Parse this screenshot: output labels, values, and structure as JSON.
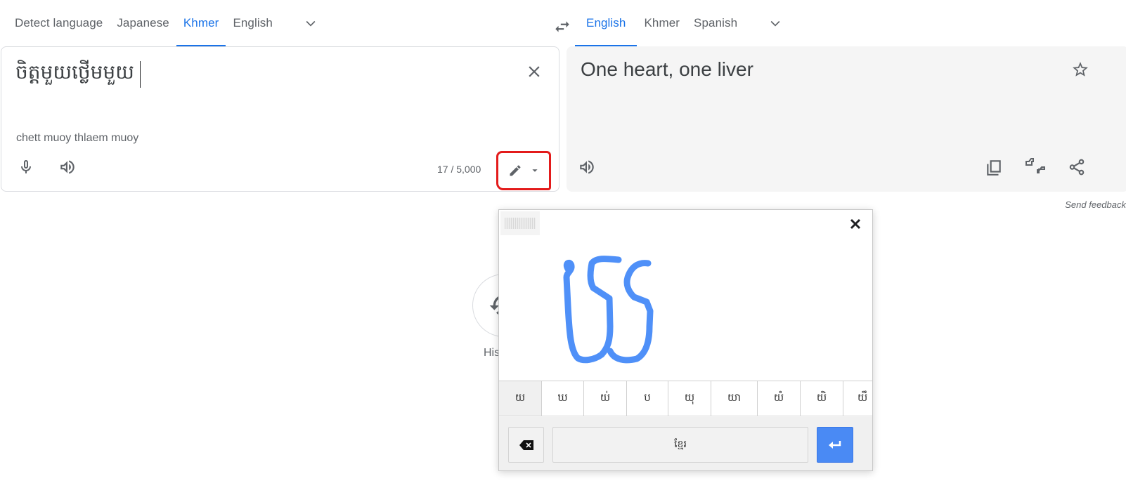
{
  "source_languages": {
    "tabs": [
      {
        "label": "Detect language",
        "active": false
      },
      {
        "label": "Japanese",
        "active": false
      },
      {
        "label": "Khmer",
        "active": true
      },
      {
        "label": "English",
        "active": false
      }
    ],
    "more_icon": "chevron-down-icon"
  },
  "swap_icon": "swap-arrows-icon",
  "target_languages": {
    "tabs": [
      {
        "label": "English",
        "active": true
      },
      {
        "label": "Khmer",
        "active": false
      },
      {
        "label": "Spanish",
        "active": false
      }
    ],
    "more_icon": "chevron-down-icon"
  },
  "source": {
    "text": "ចិត្តមួយថ្លើមមួយ",
    "transliteration": "chett muoy thlaem muoy",
    "char_count": "17 / 5,000",
    "icons": [
      "close-icon",
      "microphone-icon",
      "speaker-icon",
      "pencil-icon",
      "dropdown-arrow-icon"
    ],
    "annotation_color": "#e31b1b"
  },
  "target": {
    "text": "One heart, one liver",
    "icons": [
      "star-icon",
      "speaker-icon",
      "copy-icon",
      "thumbs-rate-icon",
      "share-icon"
    ]
  },
  "send_feedback": "Send feedback",
  "background": {
    "history_label": "History",
    "history_icon": "history-icon"
  },
  "handwriting": {
    "stroke_color": "#4f90f8",
    "candidates": [
      "យ",
      "ឃ",
      "យ់",
      "ប",
      "យុ",
      "យា",
      "យំ",
      "យិ",
      "យឹ"
    ],
    "selected_candidate": 0,
    "space_label": "ខ្មែរ",
    "accent_color": "#4a8af4",
    "icons": [
      "drag-handle-icon",
      "close-icon",
      "backspace-icon",
      "enter-icon"
    ]
  }
}
